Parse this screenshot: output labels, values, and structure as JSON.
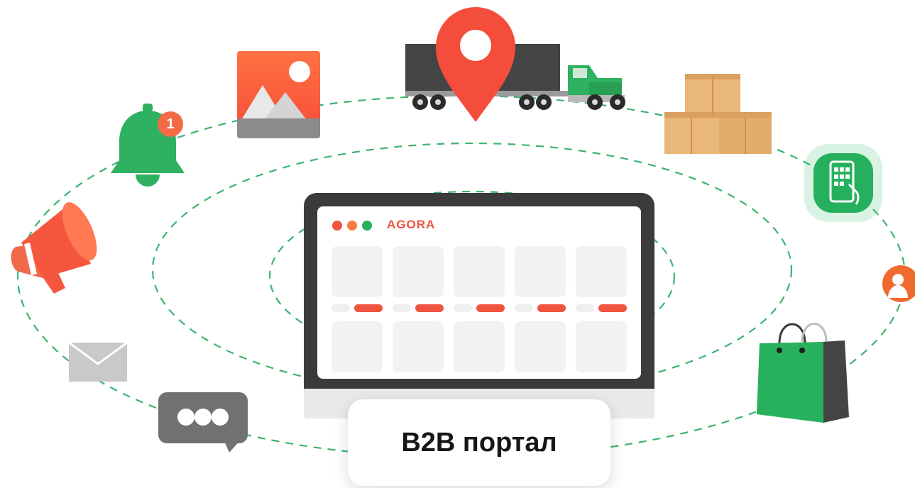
{
  "monitor": {
    "brand": "AGORA",
    "window_controls": [
      "red-dot",
      "orange-dot",
      "green-dot"
    ]
  },
  "label": {
    "text": "B2B портал"
  },
  "badges": {
    "notification_count": "1"
  },
  "icons": [
    "truck-icon",
    "map-pin-icon",
    "image-icon",
    "bell-icon",
    "megaphone-icon",
    "envelope-icon",
    "chat-bubble-icon",
    "boxes-icon",
    "tablet-app-icon",
    "user-avatar-icon",
    "shopping-bag-icon"
  ],
  "colors": {
    "accent_red": "#f0533f",
    "accent_green": "#26b05e",
    "dashed_line": "#3cb46e",
    "monitor_frame": "#3b3b3b"
  }
}
